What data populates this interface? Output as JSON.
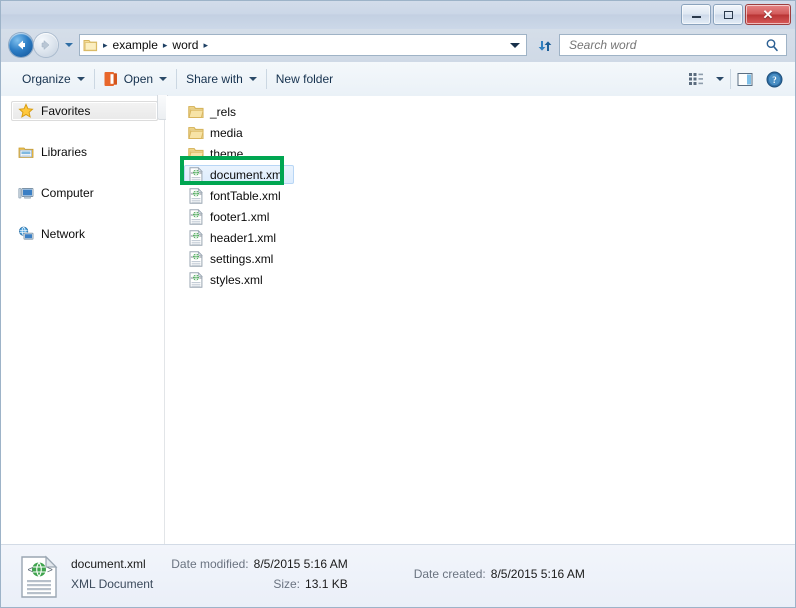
{
  "window": {
    "controls": {
      "minimize": "Minimize",
      "maximize": "Maximize",
      "close": "Close"
    }
  },
  "address": {
    "back_label": "Back",
    "forward_label": "Forward",
    "recent_pages_label": "Recent Pages",
    "breadcrumbs": [
      "example",
      "word"
    ],
    "separator": "▸",
    "refresh_label": "Refresh"
  },
  "search": {
    "placeholder": "Search word",
    "value": "",
    "icon": "search-icon"
  },
  "toolbar": {
    "organize_label": "Organize",
    "open_label": "Open",
    "open_icon": "word-document-icon",
    "share_label": "Share with",
    "newfolder_label": "New folder",
    "views_label": "Change your view",
    "preview_label": "Show the preview pane",
    "help_label": "Get help",
    "accent": "#e8672c"
  },
  "navpane": {
    "items": [
      {
        "label": "Favorites",
        "icon": "star-icon",
        "state": "hover"
      },
      {
        "label": "Libraries",
        "icon": "libraries-icon",
        "state": "normal"
      },
      {
        "label": "Computer",
        "icon": "computer-icon",
        "state": "normal"
      },
      {
        "label": "Network",
        "icon": "network-icon",
        "state": "normal"
      }
    ]
  },
  "files": {
    "items": [
      {
        "name": "_rels",
        "type": "folder",
        "icon": "folder-icon",
        "selected": false
      },
      {
        "name": "media",
        "type": "folder",
        "icon": "folder-icon",
        "selected": false
      },
      {
        "name": "theme",
        "type": "folder",
        "icon": "folder-icon",
        "selected": false
      },
      {
        "name": "document.xml",
        "type": "xml",
        "icon": "xml-file-icon",
        "selected": true
      },
      {
        "name": "fontTable.xml",
        "type": "xml",
        "icon": "xml-file-icon",
        "selected": false
      },
      {
        "name": "footer1.xml",
        "type": "xml",
        "icon": "xml-file-icon",
        "selected": false
      },
      {
        "name": "header1.xml",
        "type": "xml",
        "icon": "xml-file-icon",
        "selected": false
      },
      {
        "name": "settings.xml",
        "type": "xml",
        "icon": "xml-file-icon",
        "selected": false
      },
      {
        "name": "styles.xml",
        "type": "xml",
        "icon": "xml-file-icon",
        "selected": false
      }
    ],
    "annotation_color": "#00a651",
    "annotation_target": "document.xml"
  },
  "details": {
    "icon": "xml-document-icon",
    "name": "document.xml",
    "type": "XML Document",
    "date_modified_label": "Date modified:",
    "date_modified_value": "8/5/2015 5:16 AM",
    "size_label": "Size:",
    "size_value": "13.1 KB",
    "date_created_label": "Date created:",
    "date_created_value": "8/5/2015 5:16 AM"
  }
}
